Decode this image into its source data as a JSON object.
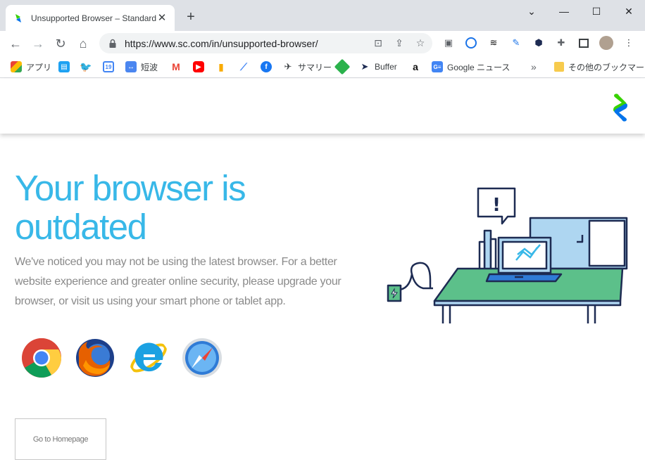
{
  "browser": {
    "tab_title": "Unsupported Browser – Standard",
    "url": "https://www.sc.com/in/unsupported-browser/",
    "bookmarks": [
      {
        "label": "アプリ"
      },
      {
        "label": "短波"
      },
      {
        "label": "サマリー"
      },
      {
        "label": "Buffer"
      },
      {
        "label": "Google ニュース"
      },
      {
        "label": "その他のブックマーク"
      }
    ]
  },
  "page": {
    "headline": "Your browser is outdated",
    "message": "We've noticed you may not be using the latest browser. For a better website experience and greater online security, please upgrade your browser, or visit us using your smart phone or tablet app.",
    "browsers": [
      "chrome-icon",
      "firefox-icon",
      "ie-icon",
      "safari-icon"
    ],
    "home_button": "Go to Homepage"
  },
  "colors": {
    "accent": "#38b8e8",
    "brand_green": "#38d200",
    "brand_blue": "#0473ea",
    "desk_green": "#5cc08a"
  }
}
